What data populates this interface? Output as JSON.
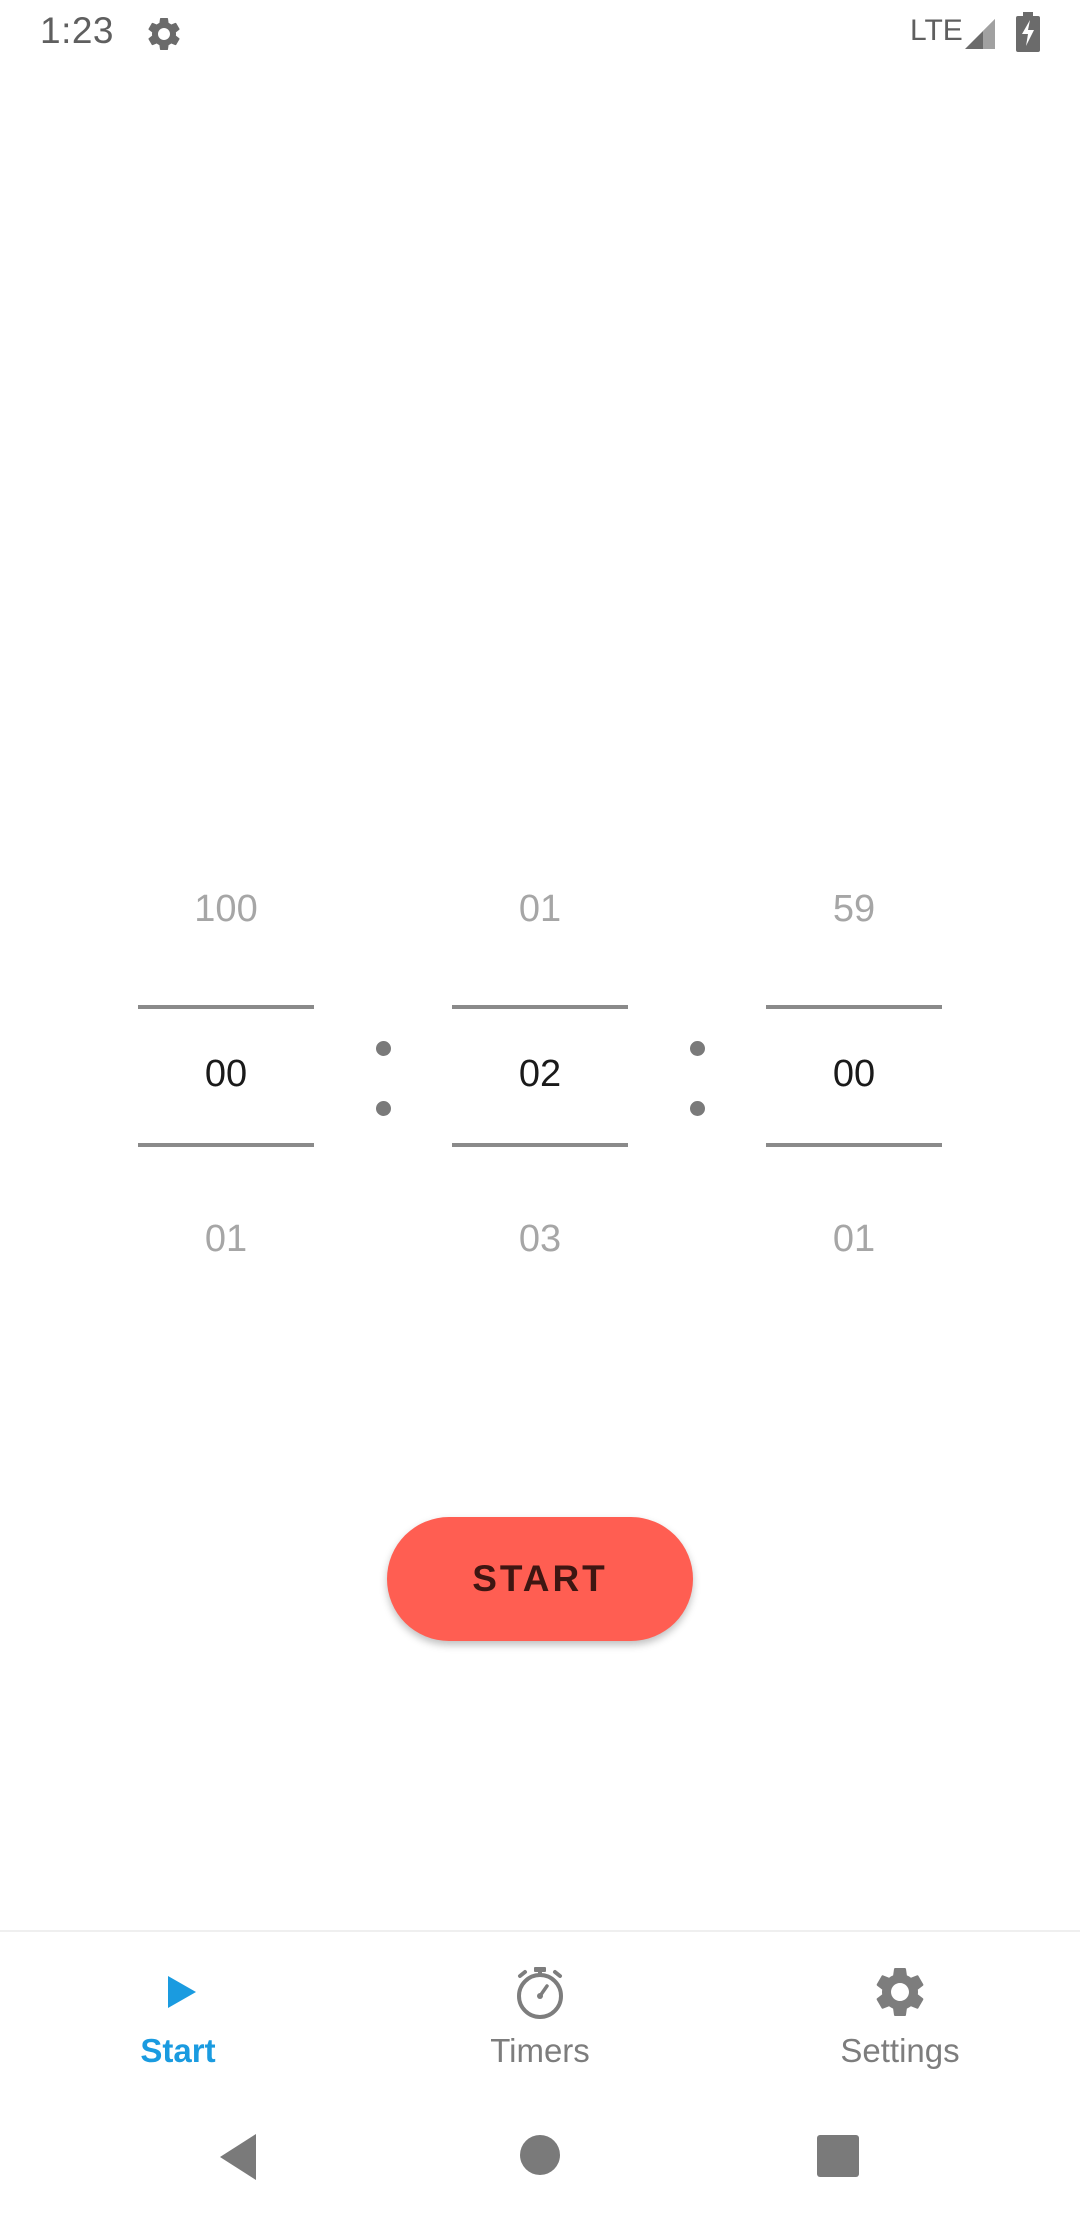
{
  "status_bar": {
    "time": "1:23",
    "network": "LTE",
    "settings_icon": "gear-icon",
    "signal_icon": "signal-icon",
    "battery_icon": "battery-charging-icon"
  },
  "timer_picker": {
    "hours": {
      "prev": "100",
      "current": "00",
      "next": "01"
    },
    "minutes": {
      "prev": "01",
      "current": "02",
      "next": "03"
    },
    "seconds": {
      "prev": "59",
      "current": "00",
      "next": "01"
    }
  },
  "start_button": {
    "label": "START"
  },
  "bottom_nav": {
    "items": [
      {
        "label": "Start",
        "icon": "play-icon",
        "active": true
      },
      {
        "label": "Timers",
        "icon": "stopwatch-icon",
        "active": false
      },
      {
        "label": "Settings",
        "icon": "gear-icon",
        "active": false
      }
    ]
  },
  "colors": {
    "accent": "#1a9be0",
    "start_button": "#ff5e52",
    "inactive": "#7d7d7d"
  }
}
